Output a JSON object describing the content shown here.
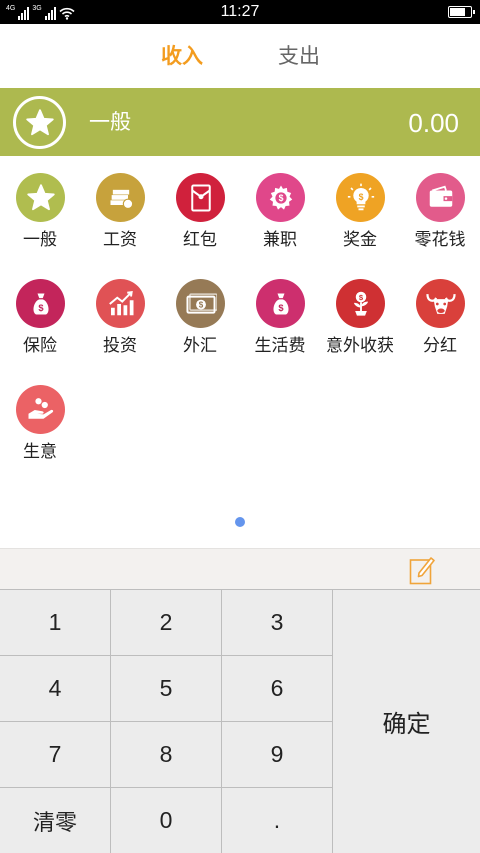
{
  "status_bar": {
    "time": "11:27",
    "network_1": "4G",
    "network_2": "3G",
    "battery_level": 0.8
  },
  "tabs": [
    {
      "label": "收入",
      "active": true
    },
    {
      "label": "支出",
      "active": false
    }
  ],
  "selected": {
    "name": "一般",
    "amount": "0.00",
    "icon": "star-icon",
    "color": "#adb94f"
  },
  "categories": [
    {
      "label": "一般",
      "icon": "star-icon",
      "color": "#b0bd4f"
    },
    {
      "label": "工资",
      "icon": "money-stack-icon",
      "color": "#c7a23c"
    },
    {
      "label": "红包",
      "icon": "red-envelope-icon",
      "color": "#d0213c"
    },
    {
      "label": "兼职",
      "icon": "gear-icon",
      "color": "#e0478a"
    },
    {
      "label": "奖金",
      "icon": "lightbulb-icon",
      "color": "#efa324"
    },
    {
      "label": "零花钱",
      "icon": "wallet-icon",
      "color": "#e25b8b"
    },
    {
      "label": "保险",
      "icon": "money-bag-icon",
      "color": "#c3255b"
    },
    {
      "label": "投资",
      "icon": "chart-up-icon",
      "color": "#e05255"
    },
    {
      "label": "外汇",
      "icon": "banknote-icon",
      "color": "#967a56"
    },
    {
      "label": "生活费",
      "icon": "money-bag-icon",
      "color": "#cd2f6e"
    },
    {
      "label": "意外收获",
      "icon": "money-plant-icon",
      "color": "#cf3033"
    },
    {
      "label": "分红",
      "icon": "bull-icon",
      "color": "#d9403b"
    },
    {
      "label": "生意",
      "icon": "hand-coins-icon",
      "color": "#eb6265"
    }
  ],
  "page_indicator": {
    "current": 1,
    "total": 1
  },
  "note": {
    "icon": "edit-note-icon"
  },
  "keypad": {
    "keys": [
      "1",
      "2",
      "3",
      "4",
      "5",
      "6",
      "7",
      "8",
      "9",
      "清零",
      "0",
      "."
    ],
    "confirm": "确定"
  },
  "colors": {
    "accent": "#f39c1f",
    "page_dot": "#6495ed"
  }
}
